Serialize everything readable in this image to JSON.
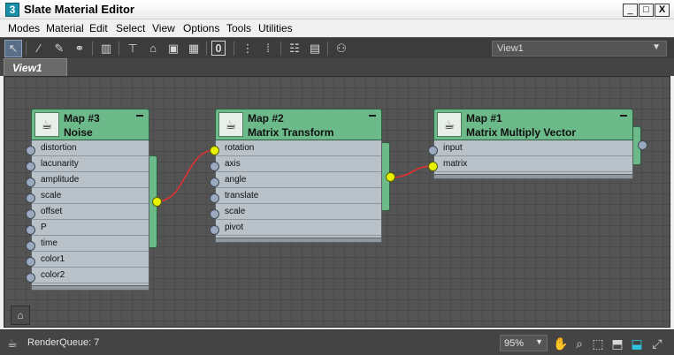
{
  "window": {
    "title": "Slate Material Editor",
    "app_icon": "3",
    "minimize_glyph": "_",
    "maximize_glyph": "□",
    "close_glyph": "X"
  },
  "menu": [
    "Modes",
    "Material",
    "Edit",
    "Select",
    "View",
    "Options",
    "Tools",
    "Utilities"
  ],
  "toolbar": {
    "icons": [
      "select-arrow-icon",
      "eyedropper-icon",
      "pick-material-icon",
      "put-to-scene-icon",
      "delete-icon",
      "move-children-icon",
      "lock-icon",
      "background-icon",
      "checker-icon",
      "sample-slot-icon",
      "layout-icon",
      "layout-children-icon",
      "hierarchy-icon",
      "node-details-icon",
      "show-map-icon"
    ],
    "view_select": "View1",
    "sample_label": "0"
  },
  "tabs": [
    "View1"
  ],
  "nodes": {
    "noise": {
      "title": "Map #3",
      "subtitle": "Noise",
      "slots": [
        "distortion",
        "lacunarity",
        "amplitude",
        "scale",
        "offset",
        "P",
        "time",
        "color1",
        "color2"
      ]
    },
    "matrix_transform": {
      "title": "Map #2",
      "subtitle": "Matrix Transform",
      "slots": [
        "rotation",
        "axis",
        "angle",
        "translate",
        "scale",
        "pivot"
      ]
    },
    "matrix_multiply": {
      "title": "Map #1",
      "subtitle": "Matrix Multiply Vector",
      "slots": [
        "input",
        "matrix"
      ]
    }
  },
  "colors": {
    "node_header": "#6cb98a",
    "node_body": "#b9c2c8",
    "socket_live": "#e6f200",
    "wire": "#e03030",
    "canvas": "#545454"
  },
  "status": {
    "render_queue": "RenderQueue: 7",
    "zoom": "95%"
  }
}
